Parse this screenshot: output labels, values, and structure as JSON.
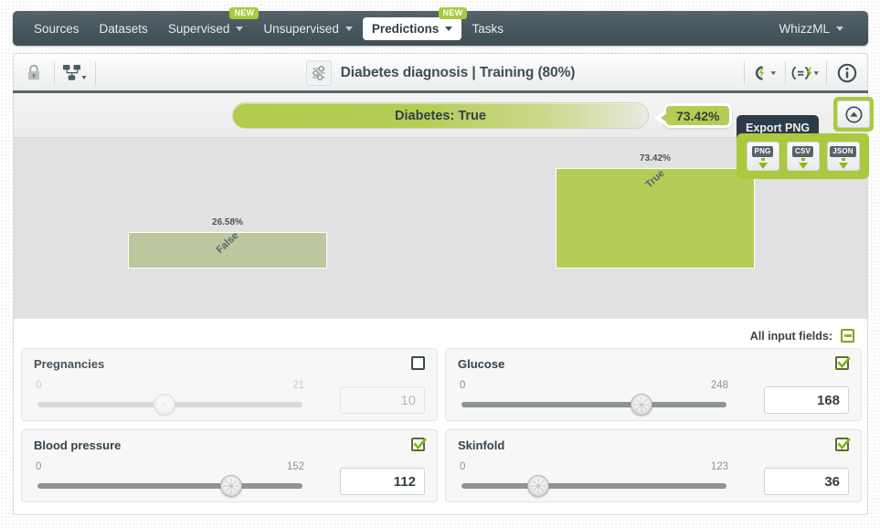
{
  "navbar": {
    "items": [
      {
        "label": "Sources",
        "caret": false,
        "badge": null,
        "active": false
      },
      {
        "label": "Datasets",
        "caret": false,
        "badge": null,
        "active": false
      },
      {
        "label": "Supervised",
        "caret": true,
        "badge": "NEW",
        "active": false
      },
      {
        "label": "Unsupervised",
        "caret": true,
        "badge": null,
        "active": false
      },
      {
        "label": "Predictions",
        "caret": true,
        "badge": "NEW",
        "active": true
      },
      {
        "label": "Tasks",
        "caret": false,
        "badge": null,
        "active": false
      }
    ],
    "account": {
      "label": "WhizzML",
      "caret": true
    }
  },
  "toolbar": {
    "lock_icon": "lock-icon",
    "model_icon": "model-tree-icon",
    "title": "Diabetes diagnosis | Training (80%)",
    "title_icon": "sliders-icon",
    "right_icons": [
      {
        "name": "batch-prediction-icon",
        "caret": true
      },
      {
        "name": "evaluation-icon",
        "caret": true
      },
      {
        "name": "info-icon",
        "caret": false
      }
    ]
  },
  "prediction": {
    "bar_label": "Diabetes: True",
    "confidence": "73.42%",
    "bar_color": "#b4cd56"
  },
  "export": {
    "tooltip": "Export PNG",
    "collapse_icon": "collapse-up-icon",
    "buttons": [
      {
        "label": "PNG",
        "name": "export-png-button"
      },
      {
        "label": "CSV",
        "name": "export-csv-button"
      },
      {
        "label": "JSON",
        "name": "export-json-button"
      }
    ],
    "panel_color": "#a9ca3e"
  },
  "chart_data": {
    "type": "bar",
    "title": "",
    "xlabel": "",
    "ylabel": "",
    "categories": [
      "False",
      "True"
    ],
    "values": [
      26.58,
      73.42
    ],
    "value_labels": [
      "26.58%",
      "73.42%"
    ],
    "colors": [
      "#bdc79d",
      "#b4cd56"
    ],
    "ylim": [
      0,
      100
    ],
    "grid": false,
    "legend": false,
    "tick_rotation": -43,
    "background": "#e1e1e1"
  },
  "inputs": {
    "all_fields_label": "All input fields:",
    "all_fields_state": "indeterminate",
    "fields": [
      {
        "name": "Pregnancies",
        "enabled": false,
        "min": "0",
        "max": "21",
        "value": "10",
        "handle_pct": 48
      },
      {
        "name": "Glucose",
        "enabled": true,
        "min": "0",
        "max": "248",
        "value": "168",
        "handle_pct": 68
      },
      {
        "name": "Blood pressure",
        "enabled": true,
        "min": "0",
        "max": "152",
        "value": "112",
        "handle_pct": 73
      },
      {
        "name": "Skinfold",
        "enabled": true,
        "min": "0",
        "max": "123",
        "value": "36",
        "handle_pct": 29
      }
    ]
  }
}
